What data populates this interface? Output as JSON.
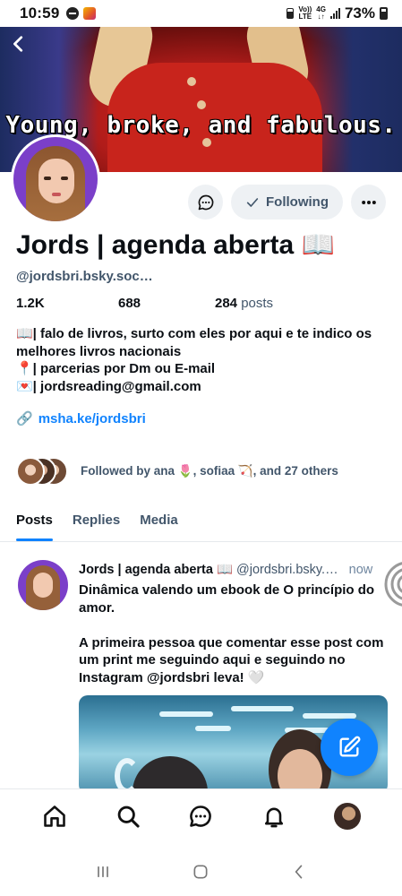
{
  "status_bar": {
    "time": "10:59",
    "network_top": "Vo))",
    "network_bottom": "LTE",
    "data_top": "4G",
    "data_bottom": "↓↑",
    "battery": "73%"
  },
  "banner": {
    "caption": "Young, broke, and fabulous."
  },
  "profile": {
    "display_name": "Jords | agenda aberta 📖",
    "handle": "@jordsbri.bsky.soc…",
    "followers": "1.2K",
    "following": "688",
    "posts_count": "284",
    "posts_label": "posts",
    "following_button_label": "Following",
    "bio_lines": [
      "📖| falo de livros, surto com eles por aqui e te indico os",
      "melhores livros nacionais",
      "📍| parcerias por Dm ou E-mail",
      "💌| jordsreading@gmail.com"
    ],
    "link_emoji": "🔗",
    "link": "msha.ke/jordsbri",
    "followed_by": "Followed by ana 🌷, sofiaa 🏹, and 27 others"
  },
  "tabs": [
    {
      "label": "Posts",
      "active": true
    },
    {
      "label": "Replies",
      "active": false
    },
    {
      "label": "Media",
      "active": false
    }
  ],
  "post": {
    "author": "Jords | agenda aberta 📖",
    "handle": "@jordsbri.bsky.…",
    "time": "now",
    "paragraphs": [
      "Dinâmica valendo um ebook de O princípio do amor.",
      "A primeira pessoa que comentar esse post com um print me seguindo aqui e seguindo no Instagram @jordsbri leva! 🤍"
    ]
  },
  "colors": {
    "accent": "#1083fe",
    "secondary_text": "#42566b",
    "button_bg": "#eef1f4"
  },
  "icons": {
    "nav": [
      "home-icon",
      "search-icon",
      "chat-icon",
      "bell-icon",
      "profile-avatar"
    ],
    "fab": "compose-icon"
  }
}
